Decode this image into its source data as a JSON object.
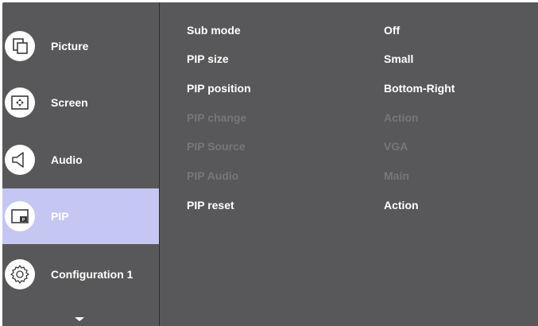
{
  "sidebar": {
    "items": [
      {
        "label": "Picture",
        "icon": "picture-icon"
      },
      {
        "label": "Screen",
        "icon": "screen-icon"
      },
      {
        "label": "Audio",
        "icon": "audio-icon"
      },
      {
        "label": "PIP",
        "icon": "pip-icon",
        "selected": true
      },
      {
        "label": "Configuration 1",
        "icon": "configuration-icon"
      }
    ],
    "more_icon": "chevron-down-icon"
  },
  "pip_icon_badge": "P",
  "settings": [
    {
      "label": "Sub mode",
      "value": "Off",
      "enabled": true
    },
    {
      "label": "PIP size",
      "value": "Small",
      "enabled": true
    },
    {
      "label": "PIP position",
      "value": "Bottom-Right",
      "enabled": true
    },
    {
      "label": "PIP change",
      "value": "Action",
      "enabled": false
    },
    {
      "label": "PIP Source",
      "value": "VGA",
      "enabled": false
    },
    {
      "label": "PIP Audio",
      "value": "Main",
      "enabled": false
    },
    {
      "label": "PIP reset",
      "value": "Action",
      "enabled": true
    }
  ],
  "colors": {
    "panel": "#58585a",
    "selected": "#c5c7f2",
    "text": "#ffffff",
    "disabled_text": "#77777a"
  }
}
